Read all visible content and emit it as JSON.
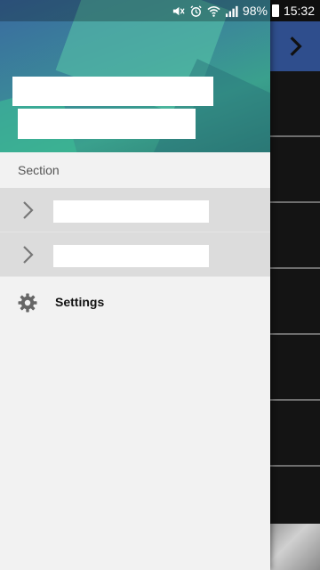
{
  "status_bar": {
    "battery_percent": "98%",
    "time": "15:32",
    "icons": [
      "mute-icon",
      "alarm-icon",
      "wifi-icon",
      "signal-icon",
      "battery-icon"
    ]
  },
  "app_bar": {
    "icons": [
      "chevron-right-icon"
    ]
  },
  "drawer": {
    "section_label": "Section",
    "items": [
      {
        "icon": "chevron-right-icon"
      },
      {
        "icon": "chevron-right-icon"
      }
    ],
    "settings": {
      "label": "Settings",
      "icon": "gear-icon"
    }
  },
  "colors": {
    "drawer_bg": "#f2f2f2",
    "item_bg": "#dcdcdc",
    "app_bar": "#2f4e8d",
    "header_start": "#3a6aa0",
    "header_end": "#2d7f74"
  }
}
